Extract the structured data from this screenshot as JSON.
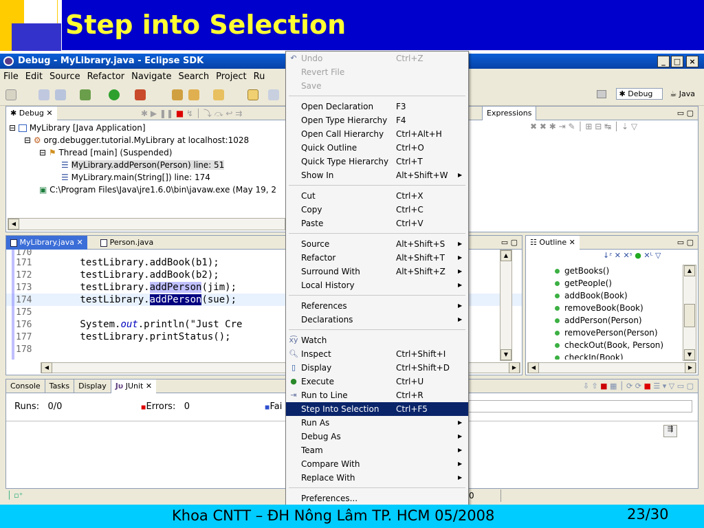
{
  "slide": {
    "title": "Step into Selection",
    "footer": "Khoa CNTT – ĐH Nông Lâm TP. HCM 05/2008",
    "page": "23/30"
  },
  "window": {
    "title": "Debug - MyLibrary.java - Eclipse SDK",
    "controls": [
      "_",
      "□",
      "×"
    ]
  },
  "menubar": [
    "File",
    "Edit",
    "Source",
    "Refactor",
    "Navigate",
    "Search",
    "Project",
    "Ru"
  ],
  "perspectives": [
    "Debug",
    "Java"
  ],
  "debug_view": {
    "tab": "Debug",
    "tree": [
      "MyLibrary [Java Application]",
      "org.debugger.tutorial.MyLibrary at localhost:1028",
      "Thread [main] (Suspended)",
      "MyLibrary.addPerson(Person) line: 51",
      "MyLibrary.main(String[]) line: 174",
      "C:\\Program Files\\Java\\jre1.6.0\\bin\\javaw.exe (May 19, 2"
    ]
  },
  "expressions_tab": "Expressions",
  "editor": {
    "tabs": [
      "MyLibrary.java",
      "Person.java"
    ],
    "lines": [
      {
        "num": "170",
        "pre": "",
        "mid": "",
        "post": ""
      },
      {
        "num": "171",
        "pre": "        testLibrary.addBook(b1);",
        "mid": "",
        "post": ""
      },
      {
        "num": "172",
        "pre": "        testLibrary.addBook(b2);",
        "mid": "",
        "post": ""
      },
      {
        "num": "173",
        "pre": "        testLibrary.",
        "mid": "addPerson",
        "post": "(jim);"
      },
      {
        "num": "174",
        "pre": "        testLibrary.",
        "mid": "addPerson",
        "post": "(sue);"
      },
      {
        "num": "175",
        "pre": "",
        "mid": "",
        "post": ""
      },
      {
        "num": "176",
        "pre": "        System.",
        "mid": "out",
        "post": ".println(\"Just Cre"
      },
      {
        "num": "177",
        "pre": "        testLibrary.printStatus();",
        "mid": "",
        "post": ""
      },
      {
        "num": "178",
        "pre": "",
        "mid": "",
        "post": ""
      }
    ]
  },
  "outline": {
    "tab": "Outline",
    "items": [
      "getBooks()",
      "getPeople()",
      "addBook(Book)",
      "removeBook(Book)",
      "addPerson(Person)",
      "removePerson(Person)",
      "checkOut(Book, Person)",
      "checkIn(Book)"
    ]
  },
  "bottom_view": {
    "tabs": [
      "Console",
      "Tasks",
      "Display",
      "JUnit"
    ],
    "runs_label": "Runs:",
    "runs_value": "0/0",
    "errors_label": "Errors:",
    "errors_value": "0",
    "failures_label": "Fai"
  },
  "status_bar": {
    "right": "0"
  },
  "context_menu": {
    "items": [
      {
        "label": "Undo",
        "shortcut": "Ctrl+Z",
        "disabled": true,
        "icon": "undo-icon"
      },
      {
        "label": "Revert File",
        "shortcut": "",
        "disabled": true
      },
      {
        "label": "Save",
        "shortcut": "",
        "disabled": true
      },
      {
        "sep": true
      },
      {
        "label": "Open Declaration",
        "shortcut": "F3"
      },
      {
        "label": "Open Type Hierarchy",
        "shortcut": "F4"
      },
      {
        "label": "Open Call Hierarchy",
        "shortcut": "Ctrl+Alt+H"
      },
      {
        "label": "Quick Outline",
        "shortcut": "Ctrl+O"
      },
      {
        "label": "Quick Type Hierarchy",
        "shortcut": "Ctrl+T"
      },
      {
        "label": "Show In",
        "shortcut": "Alt+Shift+W",
        "submenu": true
      },
      {
        "sep": true
      },
      {
        "label": "Cut",
        "shortcut": "Ctrl+X"
      },
      {
        "label": "Copy",
        "shortcut": "Ctrl+C"
      },
      {
        "label": "Paste",
        "shortcut": "Ctrl+V"
      },
      {
        "sep": true
      },
      {
        "label": "Source",
        "shortcut": "Alt+Shift+S",
        "submenu": true
      },
      {
        "label": "Refactor",
        "shortcut": "Alt+Shift+T",
        "submenu": true
      },
      {
        "label": "Surround With",
        "shortcut": "Alt+Shift+Z",
        "submenu": true
      },
      {
        "label": "Local History",
        "shortcut": "",
        "submenu": true
      },
      {
        "sep": true
      },
      {
        "label": "References",
        "shortcut": "",
        "submenu": true
      },
      {
        "label": "Declarations",
        "shortcut": "",
        "submenu": true
      },
      {
        "sep": true
      },
      {
        "label": "Watch",
        "shortcut": "",
        "icon": "watch-icon"
      },
      {
        "label": "Inspect",
        "shortcut": "Ctrl+Shift+I",
        "icon": "inspect-icon"
      },
      {
        "label": "Display",
        "shortcut": "Ctrl+Shift+D",
        "icon": "display-icon"
      },
      {
        "label": "Execute",
        "shortcut": "Ctrl+U",
        "icon": "execute-icon"
      },
      {
        "label": "Run to Line",
        "shortcut": "Ctrl+R",
        "icon": "run-to-line-icon"
      },
      {
        "label": "Step Into Selection",
        "shortcut": "Ctrl+F5",
        "selected": true
      },
      {
        "label": "Run As",
        "shortcut": "",
        "submenu": true
      },
      {
        "label": "Debug As",
        "shortcut": "",
        "submenu": true
      },
      {
        "label": "Team",
        "shortcut": "",
        "submenu": true
      },
      {
        "label": "Compare With",
        "shortcut": "",
        "submenu": true
      },
      {
        "label": "Replace With",
        "shortcut": "",
        "submenu": true
      },
      {
        "sep": true
      },
      {
        "label": "Preferences...",
        "shortcut": ""
      }
    ]
  },
  "colors": {
    "title_bg": "#0000cc",
    "title_text": "#ffff33",
    "footer_bg": "#00ccff",
    "menu_selected": "#0a246a"
  }
}
